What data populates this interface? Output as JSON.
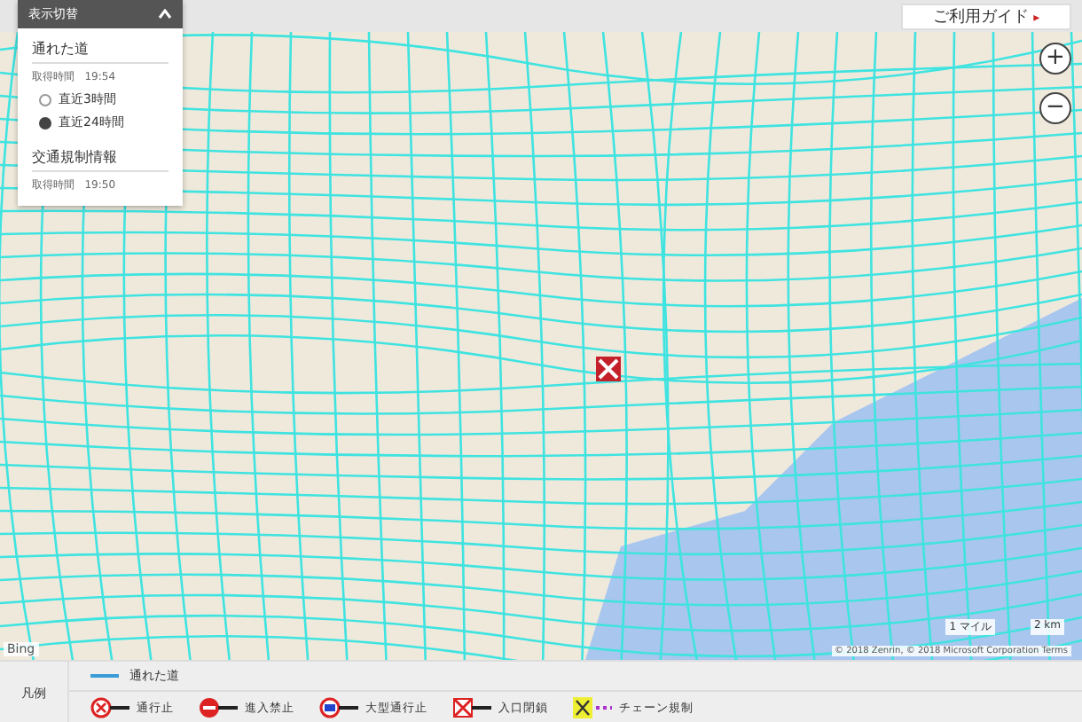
{
  "guide_button": {
    "label": "ご利用ガイド",
    "arrow": "▸"
  },
  "panel": {
    "title": "表示切替",
    "sections": [
      {
        "title": "通れた道",
        "time_label": "取得時間",
        "time": "19:54",
        "options": [
          {
            "label": "直近3時間",
            "selected": false
          },
          {
            "label": "直近24時間",
            "selected": true
          }
        ]
      },
      {
        "title": "交通規制情報",
        "time_label": "取得時間",
        "time": "19:50"
      }
    ]
  },
  "map": {
    "brand": "Bing",
    "scale": [
      "1 マイル",
      "2 km"
    ],
    "attribution": "© 2018 Zenrin, © 2018 Microsoft Corporation Terms",
    "zoom": [
      "+",
      "−"
    ]
  },
  "legend": {
    "title": "凡例",
    "line_item": "通れた道",
    "items": [
      {
        "kind": "closed",
        "label": "通行止"
      },
      {
        "kind": "noentry",
        "label": "進入禁止"
      },
      {
        "kind": "largeban",
        "label": "大型通行止"
      },
      {
        "kind": "entrance",
        "label": "入口閉鎖"
      },
      {
        "kind": "chain",
        "label": "チェーン規制"
      }
    ]
  }
}
